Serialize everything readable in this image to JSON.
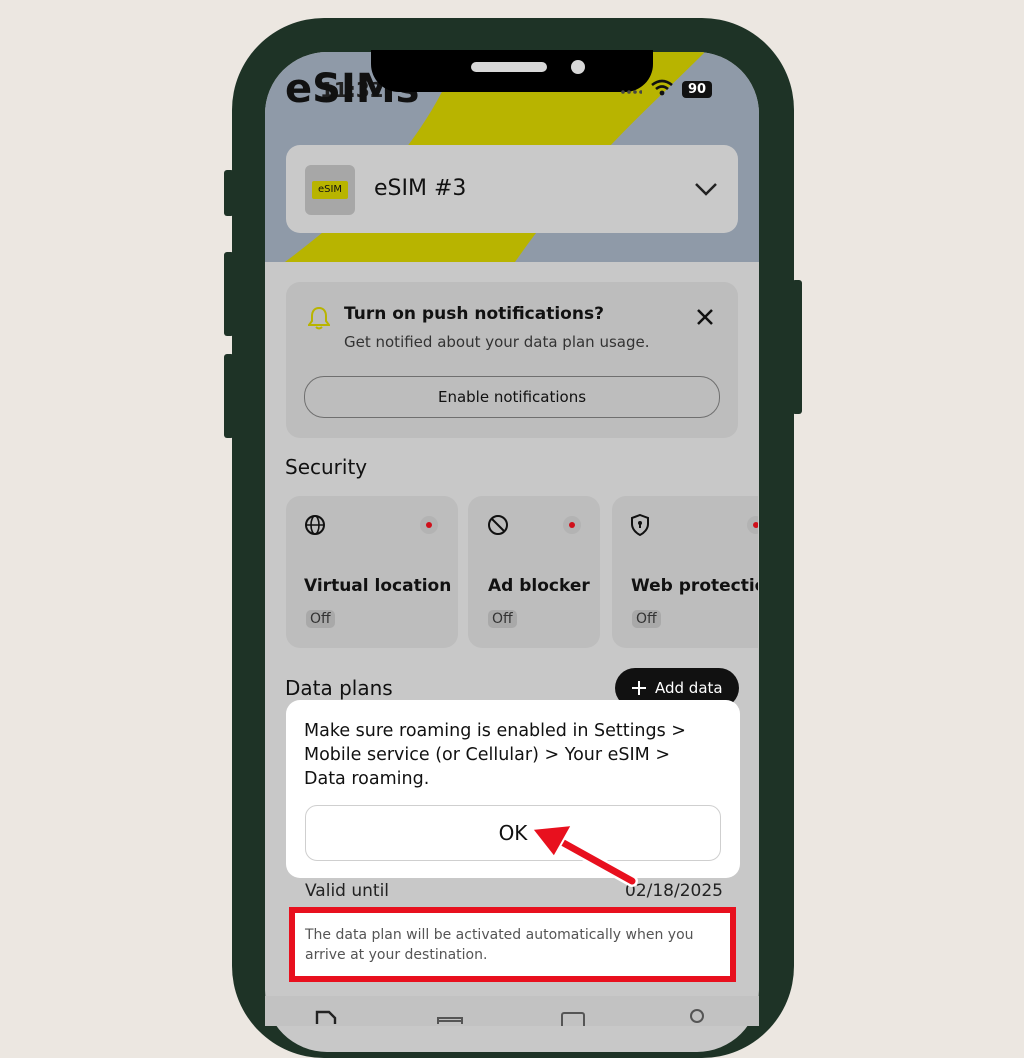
{
  "status_bar": {
    "time": "11:32",
    "battery": "90"
  },
  "app": {
    "title": "eSIMs"
  },
  "esim_selector": {
    "chip_label": "eSIM",
    "name": "eSIM #3"
  },
  "notification_card": {
    "title": "Turn on push notifications?",
    "description": "Get notified about your data plan usage.",
    "button_label": "Enable notifications"
  },
  "security": {
    "heading": "Security",
    "items": [
      {
        "label": "Virtual location",
        "status": "Off"
      },
      {
        "label": "Ad blocker",
        "status": "Off"
      },
      {
        "label": "Web protection",
        "status": "Off"
      }
    ]
  },
  "data_plans": {
    "heading": "Data plans",
    "add_button": "Add data",
    "valid_until_label": "Valid until",
    "valid_until_value": "02/18/2025",
    "activation_note": "The data plan will be activated automatically when you arrive at your destination."
  },
  "dialog": {
    "message": "Make sure roaming is enabled in Settings > Mobile service (or Cellular) > Your eSIM > Data roaming.",
    "ok_label": "OK"
  },
  "colors": {
    "accent_yellow": "#b8b400",
    "highlight_red": "#e8101e",
    "status_red": "#d0101b"
  }
}
